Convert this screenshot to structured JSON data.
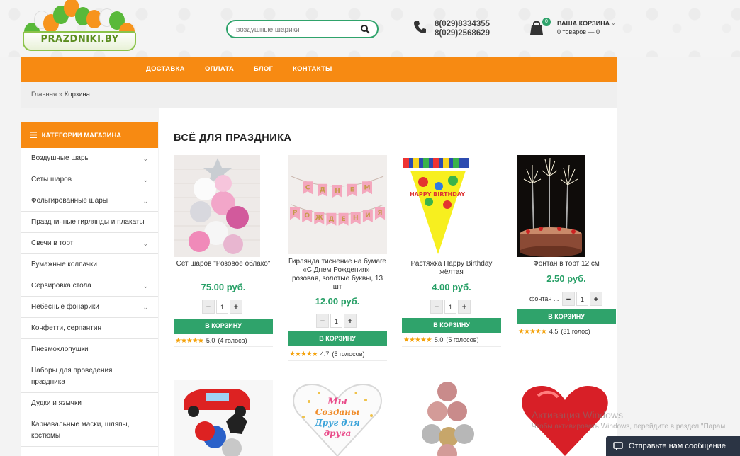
{
  "header": {
    "logo_text": "PRAZDNIKI.BY",
    "search_placeholder": "воздушные шарики",
    "phones": [
      "8(029)8334355",
      "8(029)2568629"
    ],
    "cart": {
      "title": "ВАША КОРЗИНА",
      "summary": "0 товаров — 0",
      "badge": "0"
    }
  },
  "nav": [
    "ДОСТАВКА",
    "ОПЛАТА",
    "БЛОГ",
    "КОНТАКТЫ"
  ],
  "breadcrumb": {
    "home": "Главная",
    "separator": "»",
    "current": "Корзина"
  },
  "sidebar": {
    "title": "КАТЕГОРИИ МАГАЗИНА",
    "items": [
      {
        "label": "Воздушные шары",
        "has_children": true
      },
      {
        "label": "Сеты шаров",
        "has_children": true
      },
      {
        "label": "Фольгированные шары",
        "has_children": true
      },
      {
        "label": "Праздничные гирлянды и плакаты",
        "has_children": false
      },
      {
        "label": "Свечи в торт",
        "has_children": true
      },
      {
        "label": "Бумажные колпачки",
        "has_children": false
      },
      {
        "label": "Сервировка стола",
        "has_children": true
      },
      {
        "label": "Небесные фонарики",
        "has_children": true
      },
      {
        "label": "Конфетти, серпантин",
        "has_children": false
      },
      {
        "label": "Пневмохлопушки",
        "has_children": false
      },
      {
        "label": "Наборы для проведения праздника",
        "has_children": false
      },
      {
        "label": "Дудки и язычки",
        "has_children": false
      },
      {
        "label": "Карнавальные маски, шляпы, костюмы",
        "has_children": false
      }
    ]
  },
  "main": {
    "section_title": "ВСЁ ДЛЯ ПРАЗДНИКА",
    "buy_label": "В КОРЗИНУ",
    "products": [
      {
        "name": "Сет шаров \"Розовое облако\"",
        "price": "75.00 руб.",
        "qty": "1",
        "qty_label": "",
        "rating_value": "5.0",
        "votes": "(4 голоса)"
      },
      {
        "name": "Гирлянда тиснение на бумаге «С Днем Рождения», розовая, золотые буквы, 13 шт",
        "price": "12.00 руб.",
        "qty": "1",
        "qty_label": "",
        "rating_value": "4.7",
        "votes": "(5 голосов)"
      },
      {
        "name": "Растяжка Happy Birthday жёлтая",
        "price": "4.00 руб.",
        "qty": "1",
        "qty_label": "",
        "rating_value": "5.0",
        "votes": "(5 голосов)"
      },
      {
        "name": "Фонтан в торт 12 см",
        "price": "2.50 руб.",
        "qty": "1",
        "qty_label": "фонтан ...",
        "rating_value": "4.5",
        "votes": "(31 голос)"
      }
    ],
    "image_texts": {
      "garland_letters": [
        "С",
        "Д",
        "Н",
        "Е",
        "М",
        "Р",
        "О",
        "Ж",
        "Д",
        "Е",
        "Н",
        "И",
        "Я"
      ],
      "banner": "HAPPY BIRTHDAY",
      "heart_lines": [
        "Мы",
        "Созданы",
        "Друг для",
        "друга"
      ]
    }
  },
  "watermark": {
    "line1": "Активация Windows",
    "line2": "Чтобы активировать Windows, перейдите в раздел \"Парам"
  },
  "message_button": "Отправьте нам сообщение",
  "colors": {
    "orange": "#f78a12",
    "green": "#2fa36b",
    "price_green": "#28a067",
    "star": "#f4a20c"
  }
}
